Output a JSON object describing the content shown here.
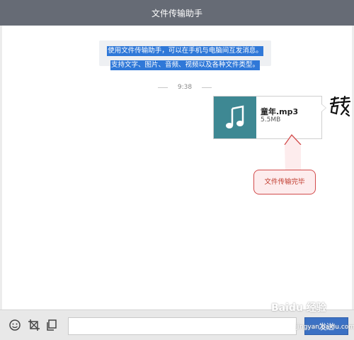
{
  "window": {
    "title": "文件传输助手"
  },
  "notice": {
    "line1": "使用文件传输助手，可以在手机与电脑间互发消息。",
    "line2": "支持文字、图片、音频、视频以及各种文件类型。"
  },
  "timestamp": "9:38",
  "message": {
    "file_name": "童年.mp3",
    "file_size": "5.5MB",
    "file_icon": "music-note-icon"
  },
  "avatar": {
    "glyph": "戴"
  },
  "annotation": {
    "text": "文件传输完毕"
  },
  "toolbar": {
    "icons": [
      "emoji-icon",
      "screenshot-icon",
      "file-copy-icon"
    ],
    "input_value": "",
    "send_label": "发送"
  },
  "watermark": {
    "text": "Baidu 经验",
    "sub": "jingyan.baidu.com"
  },
  "colors": {
    "titlebar": "#666b75",
    "file_thumb": "#3e8893",
    "send_button": "#3b71c4",
    "callout_border": "#d24b4b"
  }
}
